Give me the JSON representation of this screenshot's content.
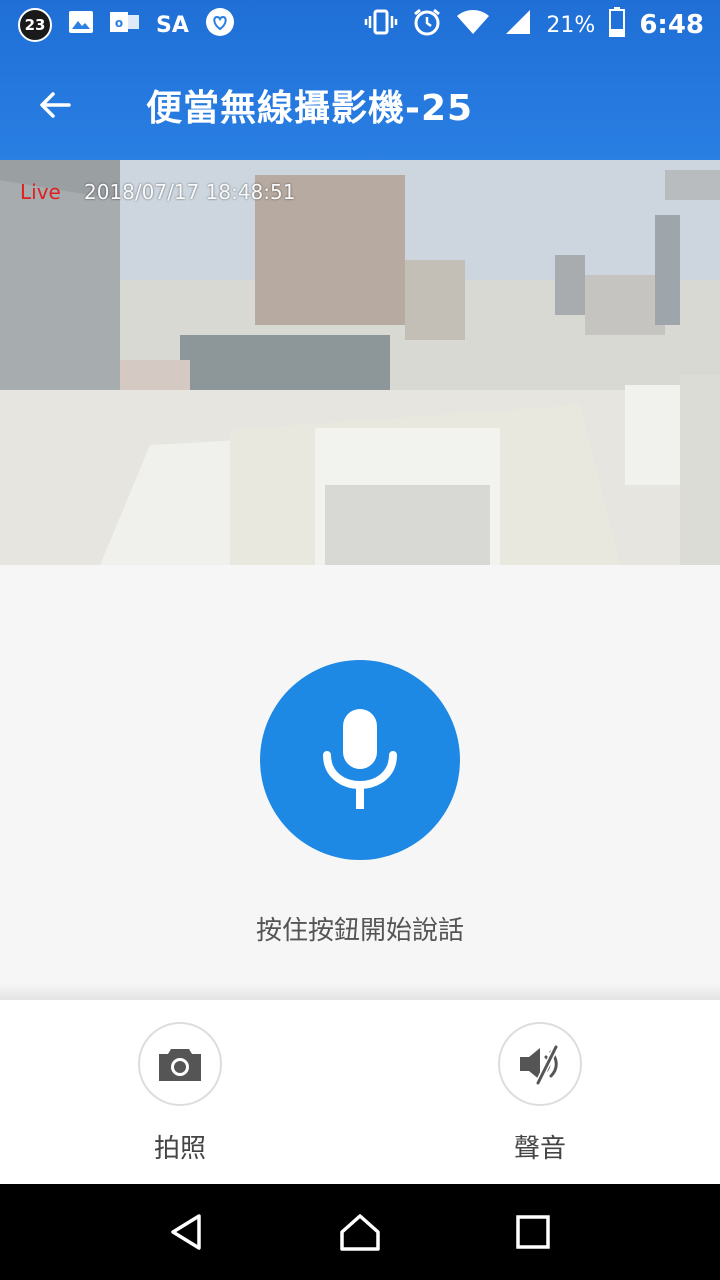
{
  "status_bar": {
    "notification_count": "23",
    "sa_label": "SA",
    "battery_percent": "21%",
    "time": "6:48"
  },
  "app_bar": {
    "title": "便當無線攝影機-25"
  },
  "video": {
    "live_label": "Live",
    "timestamp": "2018/07/17 18:48:51"
  },
  "talk": {
    "hint": "按住按鈕開始說話"
  },
  "actions": {
    "snapshot_label": "拍照",
    "sound_label": "聲音"
  },
  "colors": {
    "header": "#2a7fe3",
    "mic_button": "#1e88e5",
    "live": "#e02020"
  }
}
